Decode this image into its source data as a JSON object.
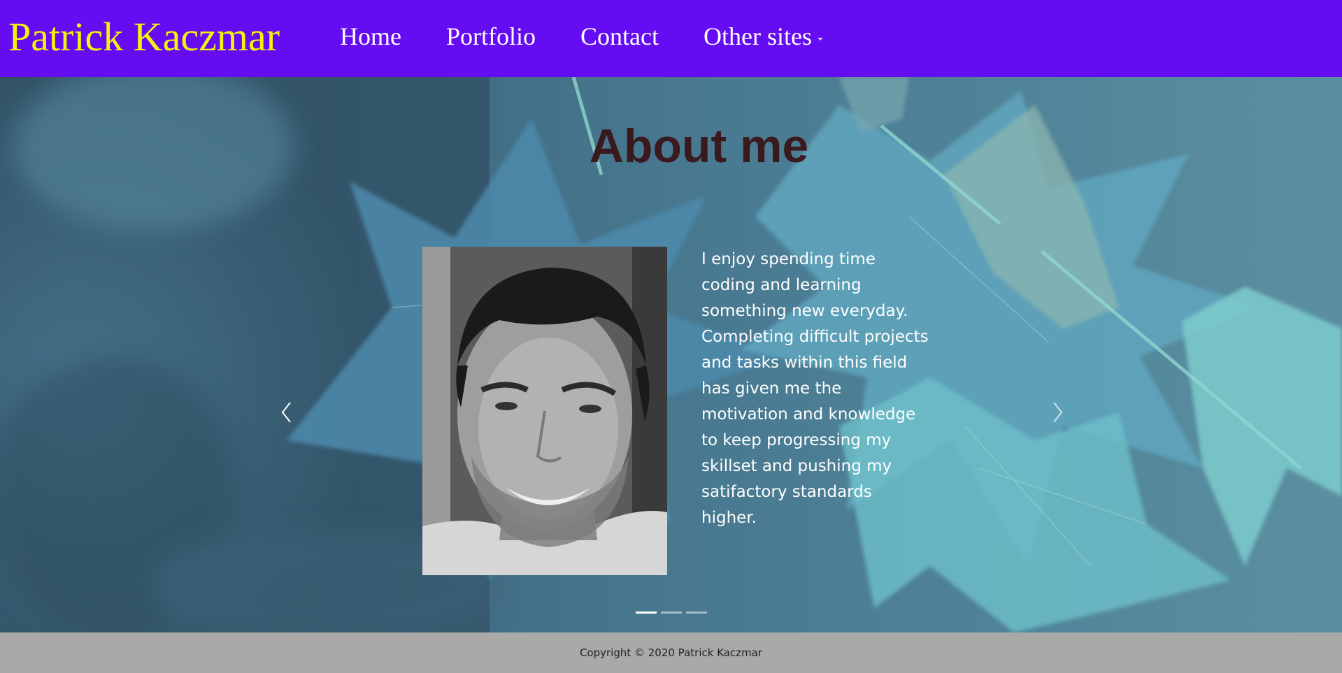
{
  "navbar": {
    "brand": "Patrick Kaczmar",
    "brand_color": "#f2f20c",
    "background_color": "#650cf2",
    "links": [
      {
        "label": "Home"
      },
      {
        "label": "Portfolio"
      },
      {
        "label": "Contact"
      },
      {
        "label": "Other sites",
        "has_dropdown": true
      }
    ]
  },
  "hero": {
    "title": "About me",
    "title_color": "#3b1a1f",
    "photo_icon": "profile-photo",
    "bio": "I enjoy spending time coding and learning something new everyday. Completing difficult projects and tasks within this field has given me the motivation and knowledge to keep progressing my skillset and pushing my satifactory standards higher.",
    "carousel": {
      "prev_icon": "chevron-left-icon",
      "next_icon": "chevron-right-icon",
      "slide_count": 3,
      "active_slide": 1
    }
  },
  "footer": {
    "copyright": "Copyright © 2020 Patrick Kaczmar",
    "background_color": "#a9a9a9"
  }
}
